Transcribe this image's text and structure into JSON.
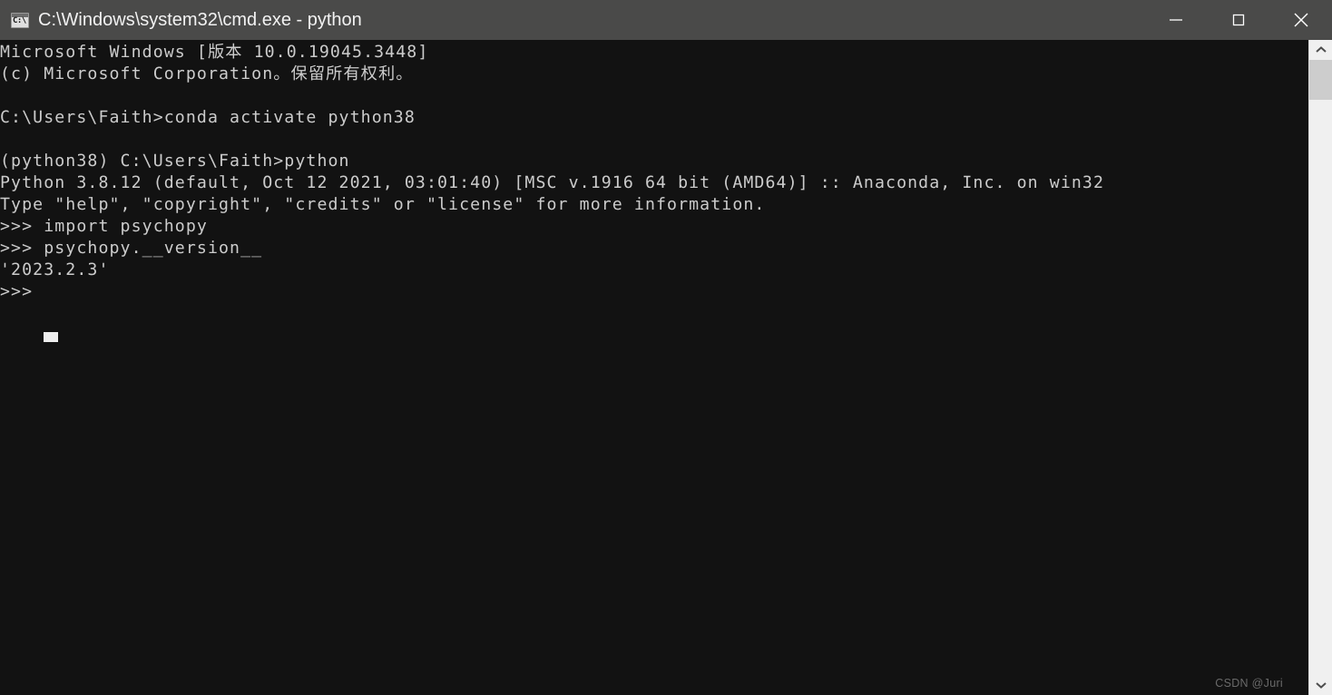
{
  "window": {
    "title": "C:\\Windows\\system32\\cmd.exe - python",
    "icon": "cmd-console-icon",
    "icon_text": "C:\\",
    "titlebar_color": "#4a4a49",
    "background_color": "#121212",
    "text_color": "#cccccc",
    "controls": {
      "minimize_label": "Minimize",
      "maximize_label": "Maximize",
      "close_label": "Close"
    }
  },
  "terminal": {
    "lines": [
      "Microsoft Windows [版本 10.0.19045.3448]",
      "(c) Microsoft Corporation。保留所有权利。",
      "",
      "C:\\Users\\Faith>conda activate python38",
      "",
      "(python38) C:\\Users\\Faith>python",
      "Python 3.8.12 (default, Oct 12 2021, 03:01:40) [MSC v.1916 64 bit (AMD64)] :: Anaconda, Inc. on win32",
      "Type \"help\", \"copyright\", \"credits\" or \"license\" for more information.",
      ">>> import psychopy",
      ">>> psychopy.__version__",
      "'2023.2.3'",
      ">>> "
    ],
    "text": "Microsoft Windows [版本 10.0.19045.3448]\n(c) Microsoft Corporation。保留所有权利。\n\nC:\\Users\\Faith>conda activate python38\n\n(python38) C:\\Users\\Faith>python\nPython 3.8.12 (default, Oct 12 2021, 03:01:40) [MSC v.1916 64 bit (AMD64)] :: Anaconda, Inc. on win32\nType \"help\", \"copyright\", \"credits\" or \"license\" for more information.\n>>> import psychopy\n>>> psychopy.__version__\n'2023.2.3'\n>>> ",
    "prompt_user": "C:\\Users\\Faith>",
    "conda_env": "(python38)",
    "python_version": "3.8.12",
    "psychopy_version": "2023.2.3",
    "cursor": "block"
  },
  "scrollbar": {
    "up_arrow": "chevron-up-icon",
    "down_arrow": "chevron-down-icon",
    "thumb_color": "#cdcdcd",
    "track_color": "#f0f0f0"
  },
  "watermark": {
    "text": "CSDN @Juri"
  }
}
